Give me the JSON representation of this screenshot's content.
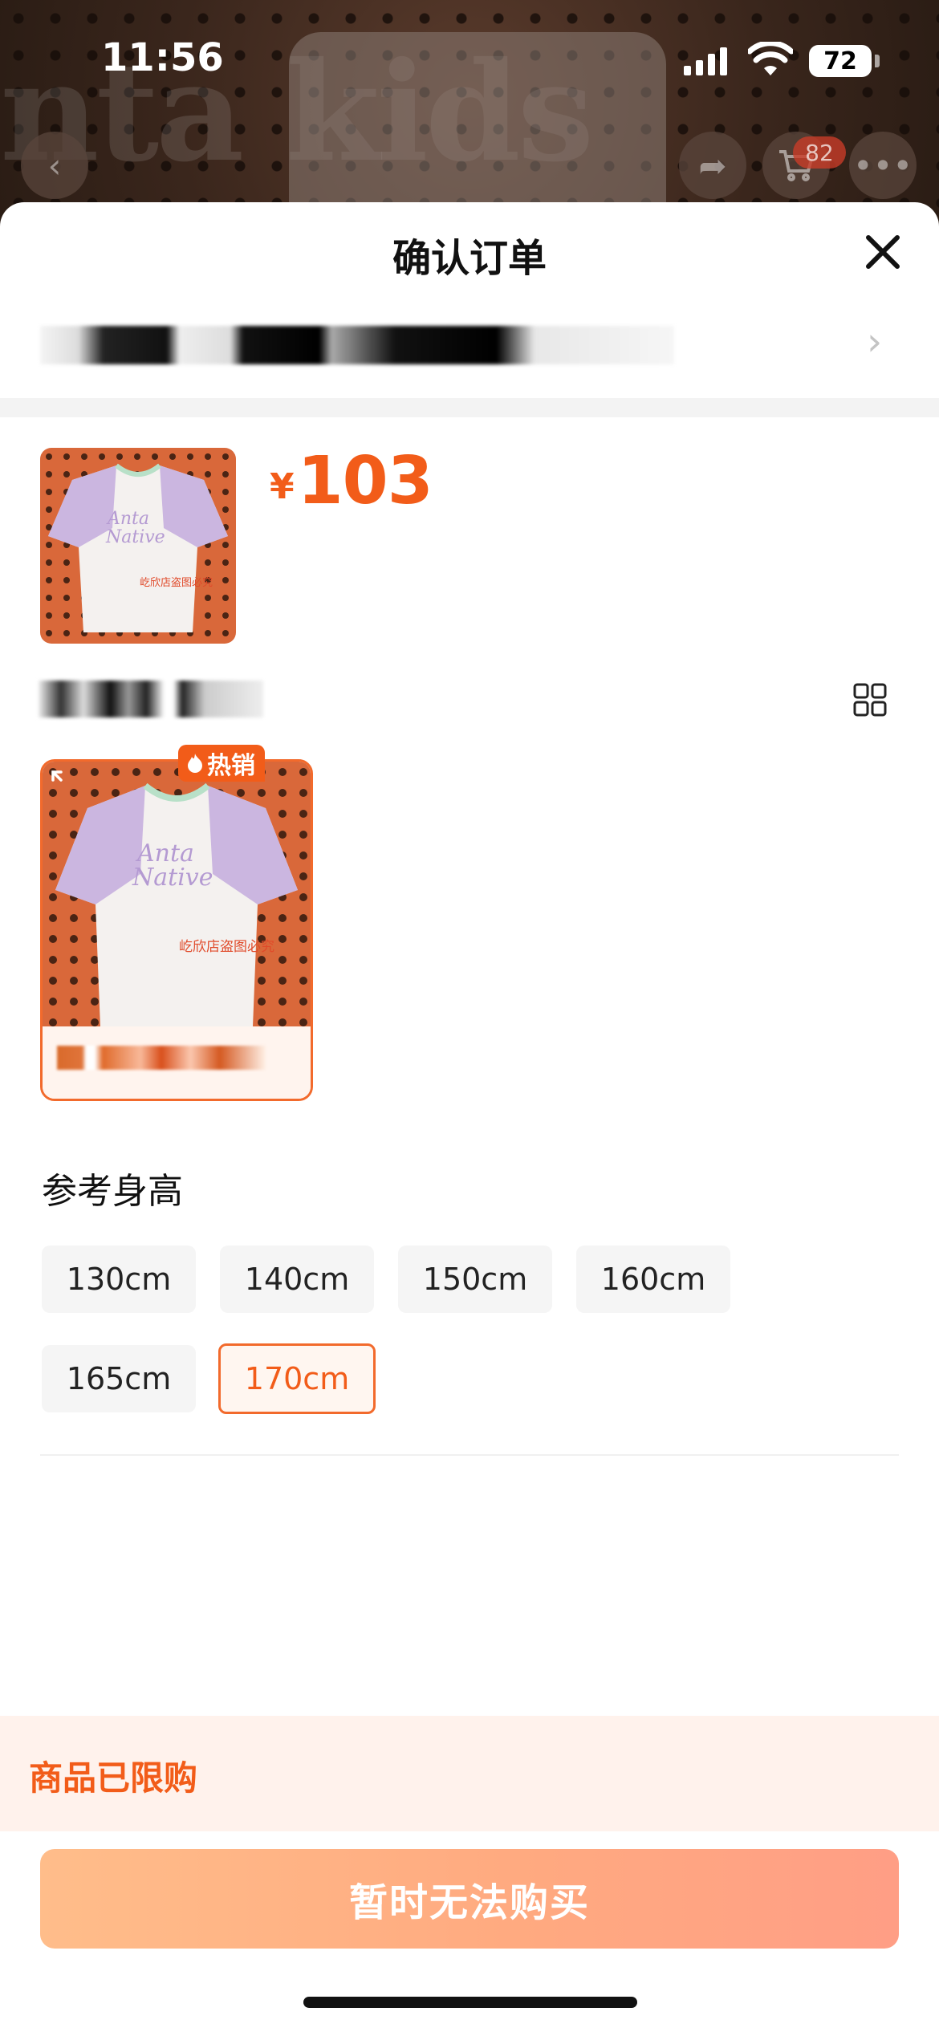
{
  "status_bar": {
    "time": "11:56",
    "battery": "72"
  },
  "background_page": {
    "logo_text": "nta kids",
    "cart_count": "82",
    "icons": [
      "back-icon",
      "share-icon",
      "cart-icon",
      "more-icon"
    ]
  },
  "sheet": {
    "title": "确认订单",
    "close_icon": "close-icon",
    "address_chevron": "›"
  },
  "product": {
    "price_symbol": "¥",
    "price": "103",
    "watermark": "屹欣店盗图必究"
  },
  "sku": {
    "hot_tag": "热销",
    "hot_icon": "flame-icon",
    "view_toggle_icon": "grid-view-icon"
  },
  "sizes": {
    "title": "参考身高",
    "options": [
      "130cm",
      "140cm",
      "150cm",
      "160cm",
      "165cm",
      "170cm"
    ],
    "selected": "170cm"
  },
  "footer": {
    "limit_notice": "商品已限购",
    "buy_button": "暂时无法购买"
  },
  "colors": {
    "accent": "#f25c19",
    "button_gradient_start": "#ffbd8a",
    "button_gradient_end": "#ff9e85",
    "limit_bg": "#fff2ec"
  }
}
